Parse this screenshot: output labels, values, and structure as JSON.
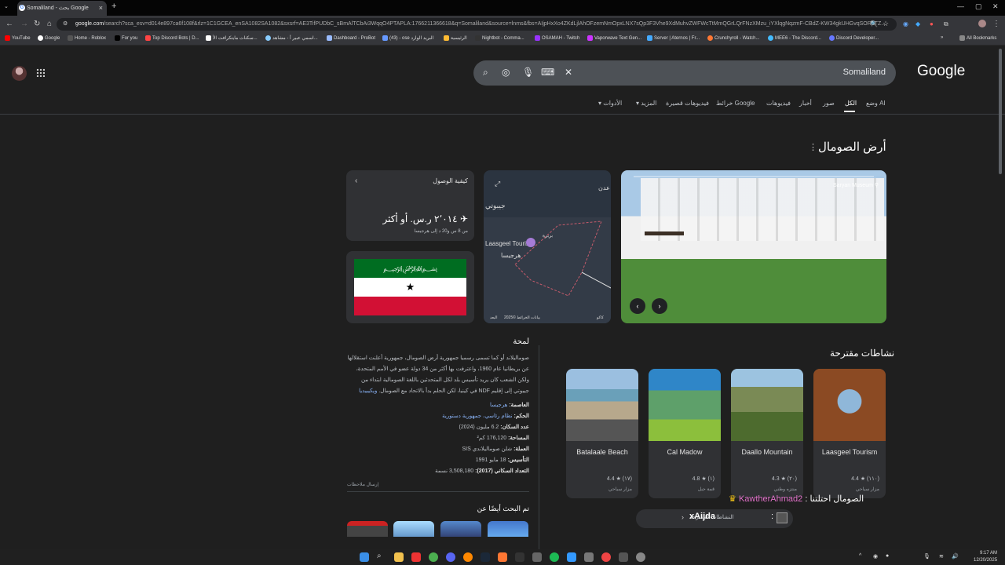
{
  "browser": {
    "tab_title": "Somaliland - بحث Google",
    "new_tab": "+",
    "url_domain": "google.com",
    "url_rest": "/search?sca_esv=d014e897ca6f108f&rlz=1C1GCEA_enSA1082SA1082&sxsrf=AE3TifPUDbC_sBmAlTCbAi3WqqO4PTAPLA:1766211366618&q=Somaliland&source=lnms&fbs=AIjpHxXo4ZKdLjlAhOFzemNmOpxLNX7sQp3F3Vhe9XdMuhvZWFWcTtMmQGrLQrFNzXMzu_iYXlqgNqzmF-CBdZ-KW34gkUHGvqSORpTZ...",
    "bookmarks": [
      "YouTube",
      "Google",
      "Home - Roblox",
      "For you",
      "Top Discord Bots | D...",
      "سكنات مايتكرافت الأ...",
      "اسمي عبير أ - مشاهد...",
      "Dashboard - ProBot",
      "(43) - ose البريد الوارد",
      "الرئيسية",
      "Nightbot - Comma...",
      "OSAMAH - Twitch",
      "Vaporwave Text Gen...",
      "Server | Aternos | Fr...",
      "Crunchyroll - Watch...",
      "MEE6 - The Discord...",
      "Discord Developer..."
    ],
    "all_bookmarks": "All Bookmarks"
  },
  "search": {
    "query": "Somaliland",
    "logo": "Google"
  },
  "tabs": [
    "وضع AI",
    "الكل",
    "صور",
    "أخبار",
    "فيديوهات",
    "خرائط Google",
    "فيديوهات قصيرة",
    "المزيد",
    "الأدوات"
  ],
  "entity": {
    "title": "أرض الصومال"
  },
  "photo": {
    "location": "Saryan Museum"
  },
  "map": {
    "labels": [
      "عدن",
      "جيبوتي",
      "بربرة",
      "هرجيسا",
      "Laasgeel Tourism",
      "بيانات الخرائط ©2025",
      "البعد",
      "كاكو"
    ]
  },
  "directions": {
    "heading": "كيفية الوصول",
    "price": "٢٬٠١٤ ر.س. أو أكثر",
    "detail": "من 8 س و20 د إلى هرجيسا"
  },
  "overview": {
    "heading": "لمحة",
    "text": "صوماليلاند أو كما تسمى رسميا جمهورية أرض الصومال، جمهورية أعلنت استقلالها عن بريطانيا عام 1960، واعترفت بها أكثر من 34 دولة عضو في الأمم المتحدة، ولكن الشعب كان يريد تأسيس بلد لكل المتحدثين باللغة الصومالية ابتداء من جيبوتي إلى إقليم NDF في كينيا، لكن الحلم بدأ بالاتحاد مع الصومال.",
    "wiki": "ويكيبيديا",
    "facts": [
      {
        "label": "العاصمة:",
        "value": "هرجيسا"
      },
      {
        "label": "الحكم:",
        "value": "نظام رئاسي، جمهورية دستورية"
      },
      {
        "label": "عدد السكان:",
        "value": "6.2 مليون (2024)"
      },
      {
        "label": "المساحة:",
        "value": "176,120 كم²"
      },
      {
        "label": "العملة:",
        "value": "شلن صوماليلاندي SIS"
      },
      {
        "label": "التأسيس:",
        "value": "18 مايو 1991"
      },
      {
        "label": "التعداد السكاني (2017):",
        "value": "3,508,180 نسمة"
      }
    ],
    "feedback": "إرسال ملاحظات"
  },
  "also_search": {
    "heading": "تم البحث أيضًا عن"
  },
  "activities": {
    "heading": "نشاطات مقترحة",
    "cards": [
      {
        "name": "Laasgeel Tourism",
        "rating": "4.4 ★ (١١٠)",
        "type": "مزار سياحي"
      },
      {
        "name": "Daallo Mountain",
        "rating": "4.3 ★ (٢٠)",
        "type": "منتزه وطني"
      },
      {
        "name": "Cal Madow",
        "rating": "4.8 ★ (١)",
        "type": "قمة جبل"
      },
      {
        "name": "Batalaale Beach",
        "rating": "4.4 ★ (١٧)",
        "type": "مزار سياحي"
      }
    ],
    "more": "النشاطات المقترحة"
  },
  "chat": {
    "user1": "KawtherAhmad2",
    "msg1": "الصومال احتلتنا",
    "user2": "xAijda"
  },
  "taskbar": {
    "time": "9:17 AM",
    "date": "12/20/2025"
  }
}
